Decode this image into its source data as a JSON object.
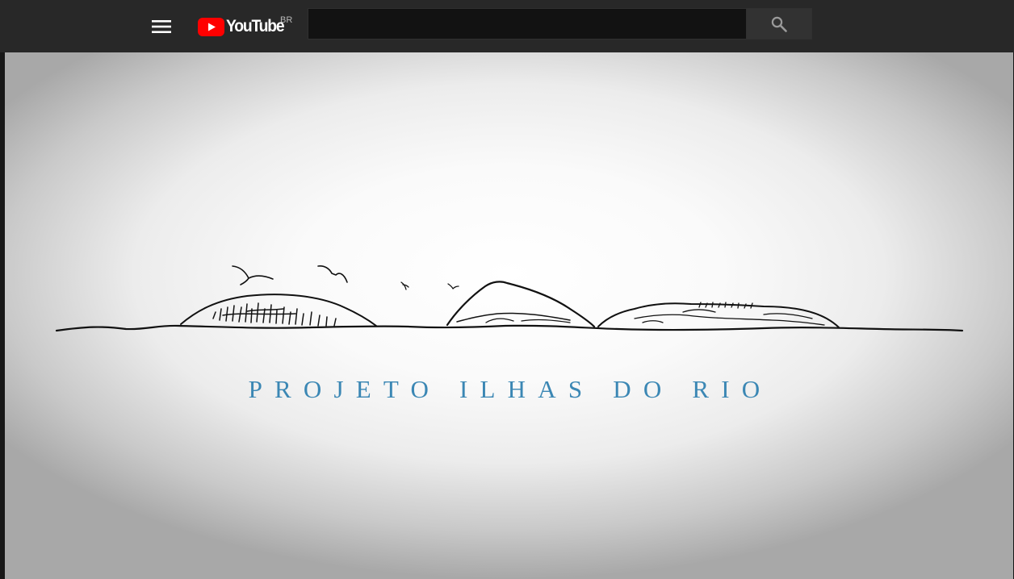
{
  "header": {
    "logo": {
      "text": "YouTube",
      "country_code": "BR",
      "brand_color": "#ff0000"
    },
    "menu_icon": "hamburger-menu-icon",
    "search": {
      "value": "",
      "placeholder": "",
      "icon": "search-icon"
    }
  },
  "video": {
    "frame_title": "PROJETO ILHAS DO RIO",
    "title_color": "#3b87b4",
    "illustration": "line-drawing-of-islands-with-seagulls"
  }
}
